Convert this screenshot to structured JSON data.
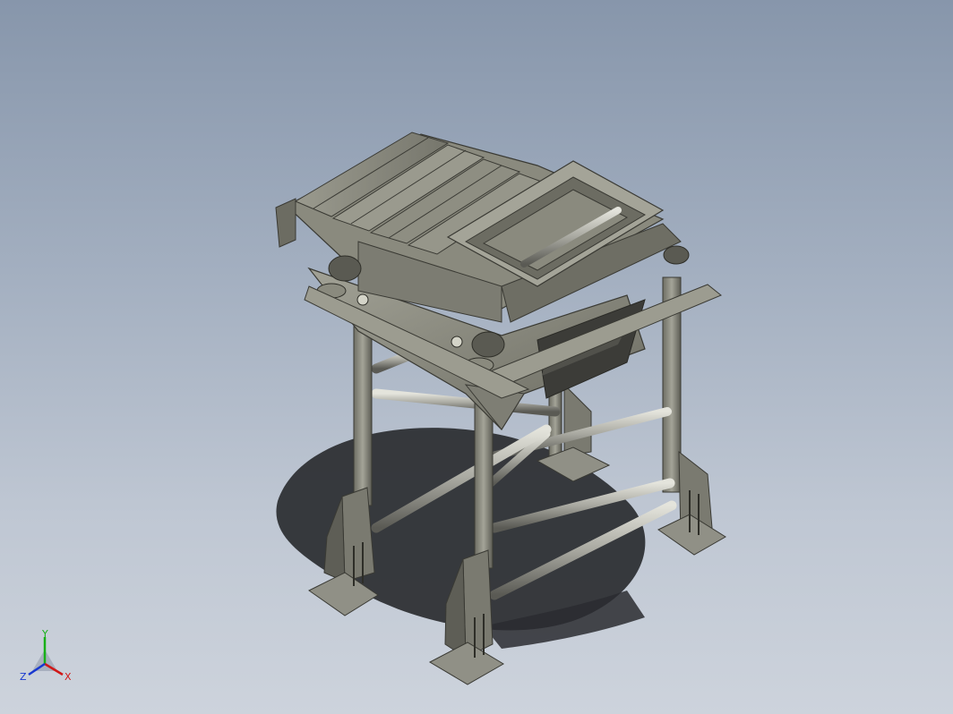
{
  "viewport": {
    "background_top": "#8796ab",
    "background_bottom": "#cdd3dc"
  },
  "model": {
    "part_color": "#8c8c80",
    "part_dark": "#4a4a44",
    "part_light": "#c8c8bc",
    "tube_color": "#b8b8b0",
    "shadow_color": "#2a2c30"
  },
  "triad": {
    "x_label": "X",
    "y_label": "Y",
    "z_label": "Z",
    "x_color": "#d01818",
    "y_color": "#18b018",
    "z_color": "#1838d0"
  }
}
